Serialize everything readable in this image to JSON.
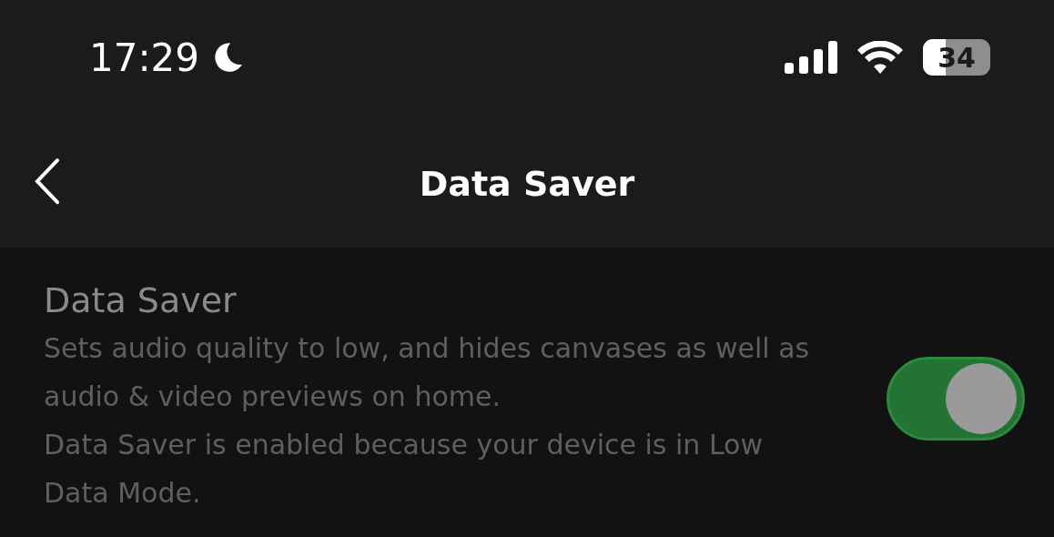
{
  "status_bar": {
    "time": "17:29",
    "battery": "34"
  },
  "header": {
    "title": "Data Saver"
  },
  "settings": [
    {
      "title": "Data Saver",
      "descriptions": [
        "Sets audio quality to low, and hides canvases as well as audio & video previews on home.",
        "Data Saver is enabled because your device is in Low Data Mode."
      ],
      "on": true,
      "disabled": true
    }
  ]
}
